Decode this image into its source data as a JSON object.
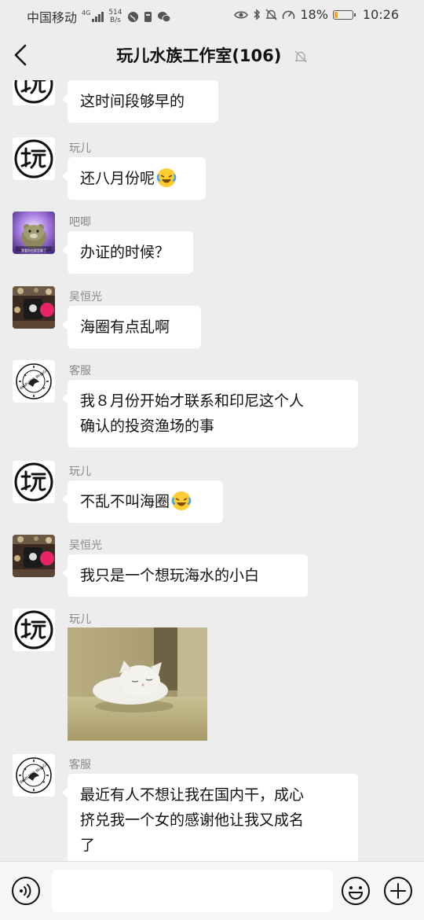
{
  "status_bar": {
    "carrier": "中国移动",
    "network_type": "4G",
    "net_speed_value": "514",
    "net_speed_unit": "B/s",
    "battery_percent": "18%",
    "battery_level": 0.18,
    "time": "10:26"
  },
  "header": {
    "title": "玩儿水族工作室(106)"
  },
  "messages": [
    {
      "sender": "",
      "text": "这时间段够早的",
      "avatar": "wan-logo"
    },
    {
      "sender": "玩儿",
      "text": "还八月份呢",
      "emoji": "laughing-crying-emoji",
      "avatar": "wan-logo"
    },
    {
      "sender": "吧唧",
      "text": "办证的时候？",
      "avatar": "hamster-photo"
    },
    {
      "sender": "吴恒光",
      "text": "海圈有点乱啊",
      "avatar": "fish-tank-photo"
    },
    {
      "sender": "客服",
      "text_lines": [
        "我８月份开始才联系和印尼这个人",
        "确认的投资渔场的事"
      ],
      "avatar": "circle-logo"
    },
    {
      "sender": "玩儿",
      "text": "不乱不叫海圈",
      "emoji": "laughing-crying-emoji",
      "avatar": "wan-logo"
    },
    {
      "sender": "吴恒光",
      "text": "我只是一个想玩海水的小白",
      "avatar": "fish-tank-photo"
    },
    {
      "sender": "玩儿",
      "image": "sleeping-cat",
      "avatar": "wan-logo"
    },
    {
      "sender": "客服",
      "text_lines": [
        "最近有人不想让我在国内干，成心",
        "挤兑我一个女的感谢他让我又成名",
        "了"
      ],
      "avatar": "circle-logo"
    }
  ],
  "avatar_texts": {
    "hamster_caption": "我看你在群里聊了",
    "circle_logo_text": "WARUCIB MissGenB"
  },
  "input_bar": {
    "placeholder": ""
  }
}
